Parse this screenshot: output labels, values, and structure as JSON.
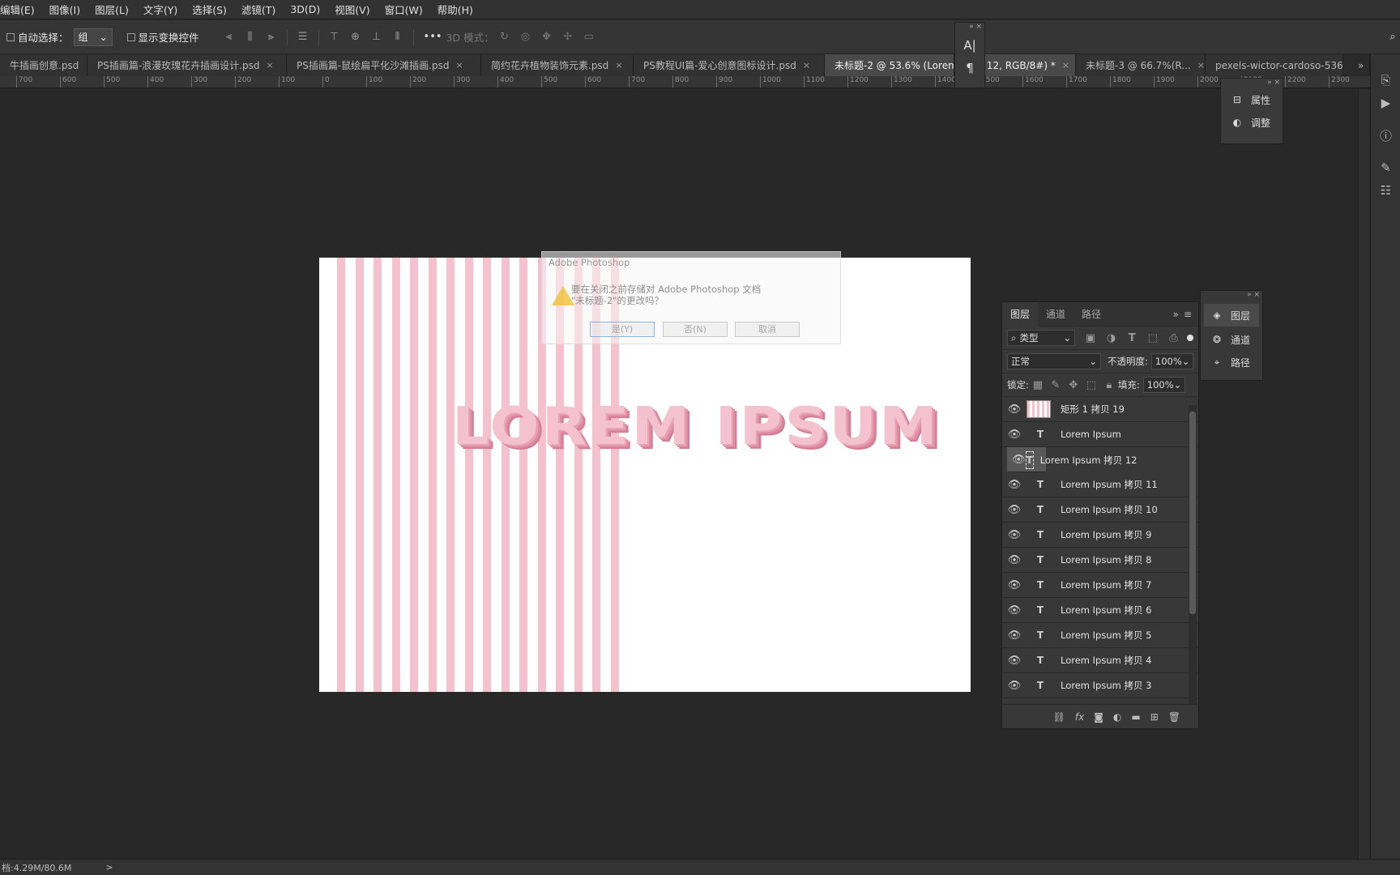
{
  "menu": [
    "编辑(E)",
    "图像(I)",
    "图层(L)",
    "文字(Y)",
    "选择(S)",
    "滤镜(T)",
    "3D(D)",
    "视图(V)",
    "窗口(W)",
    "帮助(H)"
  ],
  "options": {
    "auto_select_label": "自动选择：",
    "auto_select_value": "组",
    "show_transform_label": "显示变换控件",
    "mode3d_label": "3D 模式："
  },
  "tabs": [
    {
      "label": "牛插画创意.psd",
      "close": "×"
    },
    {
      "label": "PS插画篇-浪漫玫瑰花卉插画设计.psd",
      "close": "×"
    },
    {
      "label": "PS插画篇-鼠绘扁平化沙滩插画.psd",
      "close": "×"
    },
    {
      "label": "简约花卉植物装饰元素.psd",
      "close": "×"
    },
    {
      "label": "PS教程UI篇-爱心创意图标设计.psd",
      "close": "×"
    },
    {
      "label": "未标题-2 @ 53.6% (Lorem",
      "close": ""
    },
    {
      "label": "拷贝 12, RGB/8#) *",
      "close": "×"
    },
    {
      "label": "未标题-3 @ 66.7%(R...",
      "close": "×"
    },
    {
      "label": "pexels-wictor-cardoso-536",
      "close": ""
    }
  ],
  "ruler_ticks": [
    "700",
    "600",
    "500",
    "400",
    "300",
    "200",
    "100",
    "0",
    "100",
    "200",
    "300",
    "400",
    "500",
    "600",
    "700",
    "800",
    "900",
    "1000",
    "1100",
    "1200",
    "1300",
    "1400",
    "1500",
    "1600",
    "1700",
    "1800",
    "1900",
    "2000",
    "2100",
    "2200",
    "2300"
  ],
  "canvas": {
    "text": "LOREM IPSUM",
    "stripe_color": "#f6c1cf",
    "stripe_count": 16
  },
  "dialog": {
    "title": "Adobe Photoshop",
    "message_line1": "要在关闭之前存储对 Adobe Photoshop 文档",
    "message_line2": "\"未标题-2\"的更改吗？",
    "yes": "是(Y)",
    "no": "否(N)",
    "cancel": "取消"
  },
  "properties_panel": [
    {
      "label": "属性",
      "icon": "properties-icon"
    },
    {
      "label": "调整",
      "icon": "adjustments-icon"
    }
  ],
  "side_panel": [
    {
      "label": "图层",
      "icon": "layers-icon"
    },
    {
      "label": "通道",
      "icon": "channels-icon"
    },
    {
      "label": "路径",
      "icon": "paths-icon"
    }
  ],
  "layers_panel": {
    "tabs": [
      "图层",
      "通道",
      "路径"
    ],
    "filter_label": "类型",
    "blend_mode": "正常",
    "opacity_label": "不透明度:",
    "opacity_value": "100%",
    "lock_label": "锁定:",
    "fill_label": "填充:",
    "fill_value": "100%",
    "layers": [
      {
        "name": "矩形 1 拷贝 19",
        "type": "shape"
      },
      {
        "name": "Lorem Ipsum",
        "type": "text"
      },
      {
        "name": "Lorem Ipsum 拷贝 12",
        "type": "text"
      },
      {
        "name": "Lorem Ipsum 拷贝 11",
        "type": "text"
      },
      {
        "name": "Lorem Ipsum 拷贝 10",
        "type": "text"
      },
      {
        "name": "Lorem Ipsum 拷贝 9",
        "type": "text"
      },
      {
        "name": "Lorem Ipsum 拷贝 8",
        "type": "text"
      },
      {
        "name": "Lorem Ipsum 拷贝 7",
        "type": "text"
      },
      {
        "name": "Lorem Ipsum 拷贝 6",
        "type": "text"
      },
      {
        "name": "Lorem Ipsum 拷贝 5",
        "type": "text"
      },
      {
        "name": "Lorem Ipsum 拷贝 4",
        "type": "text"
      },
      {
        "name": "Lorem Ipsum 拷贝 3",
        "type": "text"
      }
    ],
    "selected_layer": "Lorem Ipsum 拷贝 12"
  },
  "status": {
    "doc_size": "档:4.29M/80.6M",
    "arrow": ">"
  }
}
